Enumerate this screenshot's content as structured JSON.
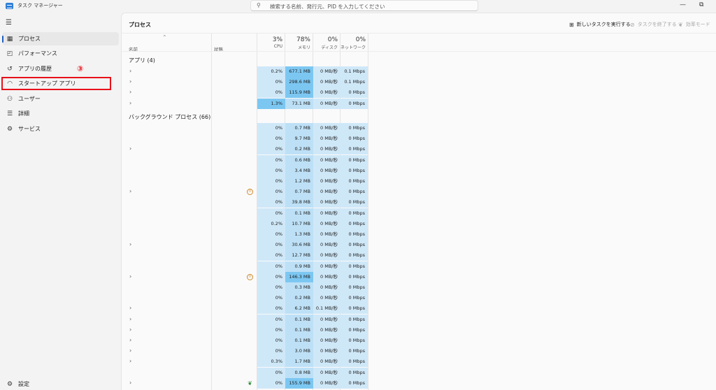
{
  "window": {
    "title": "タスク マネージャー",
    "search_placeholder": "検索する名前、発行元、PID を入力してください",
    "minimize": "—",
    "restore": "⧉"
  },
  "sidebar": {
    "items": [
      {
        "label": "プロセス",
        "icon": "processes-icon",
        "glyph": "▦",
        "active": true
      },
      {
        "label": "パフォーマンス",
        "icon": "performance-icon",
        "glyph": "◰",
        "active": false
      },
      {
        "label": "アプリの履歴",
        "icon": "app-history-icon",
        "glyph": "↺",
        "active": false
      },
      {
        "label": "スタートアップ アプリ",
        "icon": "startup-apps-icon",
        "glyph": "◠",
        "active": false
      },
      {
        "label": "ユーザー",
        "icon": "users-icon",
        "glyph": "⚇",
        "active": false
      },
      {
        "label": "詳細",
        "icon": "details-icon",
        "glyph": "☰",
        "active": false
      },
      {
        "label": "サービス",
        "icon": "services-icon",
        "glyph": "⚙",
        "active": false
      }
    ],
    "settings_label": "設定",
    "step_marker": "③"
  },
  "main": {
    "title": "プロセス",
    "commands": {
      "run_new_task": "新しいタスクを実行する",
      "end_task": "タスクを終了する",
      "efficiency_mode": "効率モード"
    },
    "columns": {
      "name": "名前",
      "status": "状態",
      "cpu_pct": "3%",
      "cpu": "CPU",
      "memory_pct": "78%",
      "memory": "メモリ",
      "disk_pct": "0%",
      "disk": "ディスク",
      "network_pct": "0%",
      "network": "ネットワーク"
    },
    "apps_group": "アプリ (4)",
    "background_group": "バックグラウンド プロセス (66)",
    "apps": [
      {
        "cpu": "0.2%",
        "mem": "677.1 MB",
        "disk": "0 MB/秒",
        "net": "0.1 Mbps",
        "expand": true
      },
      {
        "cpu": "0%",
        "mem": "298.6 MB",
        "disk": "0 MB/秒",
        "net": "0.1 Mbps",
        "expand": true
      },
      {
        "cpu": "0%",
        "mem": "115.9 MB",
        "disk": "0 MB/秒",
        "net": "0 Mbps",
        "expand": true
      },
      {
        "cpu": "1.3%",
        "mem": "73.1 MB",
        "disk": "0 MB/秒",
        "net": "0 Mbps",
        "expand": true
      }
    ],
    "background": [
      {
        "cpu": "0%",
        "mem": "0.7 MB",
        "disk": "0 MB/秒",
        "net": "0 Mbps",
        "expand": false
      },
      {
        "cpu": "0%",
        "mem": "9.7 MB",
        "disk": "0 MB/秒",
        "net": "0 Mbps",
        "expand": false
      },
      {
        "cpu": "0%",
        "mem": "0.2 MB",
        "disk": "0 MB/秒",
        "net": "0 Mbps",
        "expand": true
      },
      {
        "cpu": "0%",
        "mem": "0.6 MB",
        "disk": "0 MB/秒",
        "net": "0 Mbps",
        "expand": false
      },
      {
        "cpu": "0%",
        "mem": "3.4 MB",
        "disk": "0 MB/秒",
        "net": "0 Mbps",
        "expand": false
      },
      {
        "cpu": "0%",
        "mem": "1.2 MB",
        "disk": "0 MB/秒",
        "net": "0 Mbps",
        "expand": false
      },
      {
        "cpu": "0%",
        "mem": "0.7 MB",
        "disk": "0 MB/秒",
        "net": "0 Mbps",
        "expand": true,
        "status": "paused"
      },
      {
        "cpu": "0%",
        "mem": "39.8 MB",
        "disk": "0 MB/秒",
        "net": "0 Mbps",
        "expand": false
      },
      {
        "cpu": "0%",
        "mem": "0.1 MB",
        "disk": "0 MB/秒",
        "net": "0 Mbps",
        "expand": false
      },
      {
        "cpu": "0.2%",
        "mem": "10.7 MB",
        "disk": "0 MB/秒",
        "net": "0 Mbps",
        "expand": false
      },
      {
        "cpu": "0%",
        "mem": "1.3 MB",
        "disk": "0 MB/秒",
        "net": "0 Mbps",
        "expand": false
      },
      {
        "cpu": "0%",
        "mem": "30.6 MB",
        "disk": "0 MB/秒",
        "net": "0 Mbps",
        "expand": true
      },
      {
        "cpu": "0%",
        "mem": "12.7 MB",
        "disk": "0 MB/秒",
        "net": "0 Mbps",
        "expand": false
      },
      {
        "cpu": "0%",
        "mem": "0.9 MB",
        "disk": "0 MB/秒",
        "net": "0 Mbps",
        "expand": false
      },
      {
        "cpu": "0%",
        "mem": "146.3 MB",
        "disk": "0 MB/秒",
        "net": "0 Mbps",
        "expand": true,
        "status": "paused"
      },
      {
        "cpu": "0%",
        "mem": "0.3 MB",
        "disk": "0 MB/秒",
        "net": "0 Mbps",
        "expand": false
      },
      {
        "cpu": "0%",
        "mem": "0.2 MB",
        "disk": "0 MB/秒",
        "net": "0 Mbps",
        "expand": false
      },
      {
        "cpu": "0%",
        "mem": "6.2 MB",
        "disk": "0.1 MB/秒",
        "net": "0 Mbps",
        "expand": true
      },
      {
        "cpu": "0%",
        "mem": "0.1 MB",
        "disk": "0 MB/秒",
        "net": "0 Mbps",
        "expand": true
      },
      {
        "cpu": "0%",
        "mem": "0.1 MB",
        "disk": "0 MB/秒",
        "net": "0 Mbps",
        "expand": true
      },
      {
        "cpu": "0%",
        "mem": "0.1 MB",
        "disk": "0 MB/秒",
        "net": "0 Mbps",
        "expand": true
      },
      {
        "cpu": "0%",
        "mem": "3.0 MB",
        "disk": "0 MB/秒",
        "net": "0 Mbps",
        "expand": true
      },
      {
        "cpu": "0.3%",
        "mem": "1.7 MB",
        "disk": "0 MB/秒",
        "net": "0 Mbps",
        "expand": true
      },
      {
        "cpu": "0%",
        "mem": "0.8 MB",
        "disk": "0 MB/秒",
        "net": "0 Mbps",
        "expand": false
      },
      {
        "cpu": "0%",
        "mem": "155.9 MB",
        "disk": "0 MB/秒",
        "net": "0 Mbps",
        "expand": true,
        "status": "efficiency"
      }
    ]
  },
  "colors": {
    "heat_low": "#cfe8f8",
    "heat_mid": "#bde0f6",
    "heat_high": "#7cc7f2",
    "highlight": "#e8101a",
    "accent": "#1f5fbf"
  }
}
